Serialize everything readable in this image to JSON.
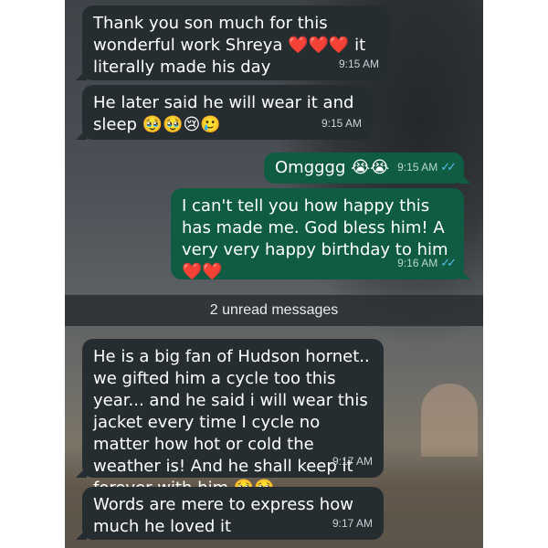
{
  "messages": [
    {
      "direction": "in",
      "text": "Thank you son much for this wonderful work Shreya ❤️❤️❤️ it literally made his day",
      "time": "9:15 AM"
    },
    {
      "direction": "in",
      "text": "He later said he will wear it and sleep 🥹🥹😢🥲",
      "time": "9:15 AM"
    },
    {
      "direction": "out",
      "text": "Omgggg 😭😭",
      "time": "9:15 AM",
      "status": "read"
    },
    {
      "direction": "out",
      "text": "I can't tell you how happy this has made me. God bless him! A very very happy birthday to him ❤️❤️",
      "time": "9:16 AM",
      "status": "read"
    },
    {
      "direction": "in",
      "text": "He is a big fan of Hudson hornet.. we gifted him a cycle too this year... and he said i will wear this jacket every time I cycle no matter how hot or cold the weather is! And he shall keep it forever with him 🥹🥹",
      "time": "9:17 AM"
    },
    {
      "direction": "in",
      "text": "Words are mere to express how much he loved it",
      "time": "9:17 AM"
    }
  ],
  "unread_divider": "2 unread messages",
  "colors": {
    "incoming_bubble": "#262d31",
    "outgoing_bubble": "#0f5c43",
    "read_ticks": "#53bdeb"
  }
}
